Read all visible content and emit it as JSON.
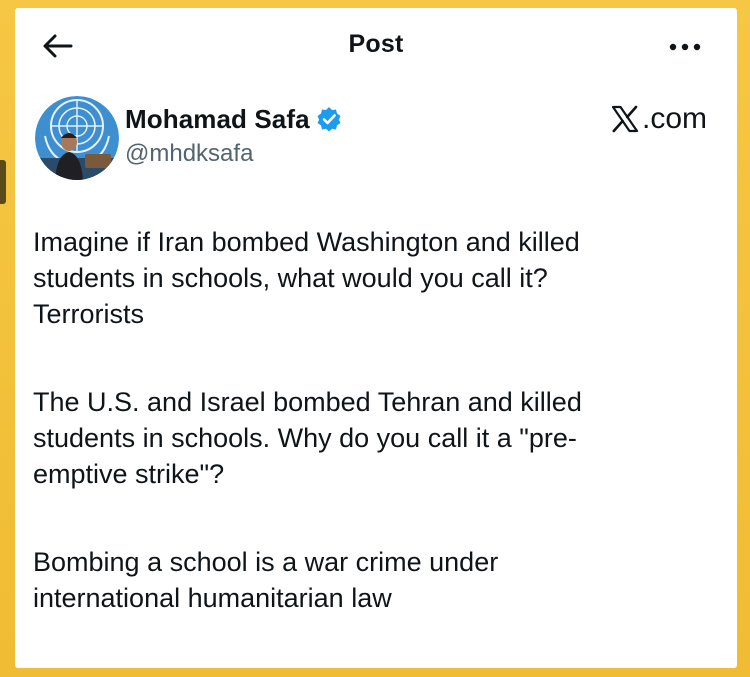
{
  "header": {
    "title": "Post",
    "back_icon": "arrow-left-icon",
    "more_icon": "more-horizontal-icon"
  },
  "author": {
    "name": "Mohamad Safa",
    "handle": "@mhdksafa",
    "verified_icon": "verified-badge-icon",
    "avatar": "profile-photo"
  },
  "brand": {
    "label": ".com",
    "logo_icon": "x-logo-icon"
  },
  "post": {
    "paragraphs": [
      "Imagine if Iran bombed Washington and killed\nstudents in schools, what would you call it?\nTerrorists",
      "The U.S. and Israel bombed Tehran and killed\nstudents in schools. Why do you call it a \"pre-\nemptive strike\"?",
      "Bombing a school is a war crime under\ninternational humanitarian law"
    ]
  },
  "colors": {
    "frame": "#f3c23a",
    "card": "#ffffff",
    "text": "#0f1419",
    "secondary_text": "#536471",
    "verified": "#1d9bf0"
  }
}
